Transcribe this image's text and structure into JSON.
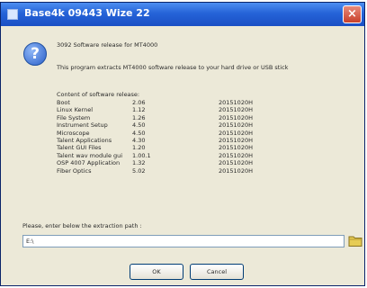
{
  "window": {
    "title": "Base4k 09443 Wize 22",
    "close_glyph": "×"
  },
  "dialog": {
    "icon_glyph": "?",
    "heading": "3092 Software release for MT4000",
    "intro": "This program extracts MT4000 software release to your hard drive or USB stick",
    "content_label": "Content of software release:",
    "rows": [
      {
        "name": "Boot",
        "version": "2.06",
        "date": "20151020H"
      },
      {
        "name": "Linux Kernel",
        "version": "1.12",
        "date": "20151020H"
      },
      {
        "name": "File System",
        "version": "1.26",
        "date": "20151020H"
      },
      {
        "name": "Instrument Setup",
        "version": "4.50",
        "date": "20151020H"
      },
      {
        "name": "Microscope",
        "version": "4.50",
        "date": "20151020H"
      },
      {
        "name": "Talent Applications",
        "version": "4.30",
        "date": "20151020H"
      },
      {
        "name": "Talent GUI Files",
        "version": "1.20",
        "date": "20151020H"
      },
      {
        "name": "Talent wav module gui",
        "version": "1.00.1",
        "date": "20151020H"
      },
      {
        "name": "OSP 4007 Application",
        "version": "1.32",
        "date": "20151020H"
      },
      {
        "name": "Fiber Optics",
        "version": "5.02",
        "date": "20151020H"
      }
    ]
  },
  "extraction": {
    "label": "Please, enter below the extraction path :",
    "path_value": "E:\\"
  },
  "buttons": {
    "ok": "OK",
    "cancel": "Cancel"
  }
}
